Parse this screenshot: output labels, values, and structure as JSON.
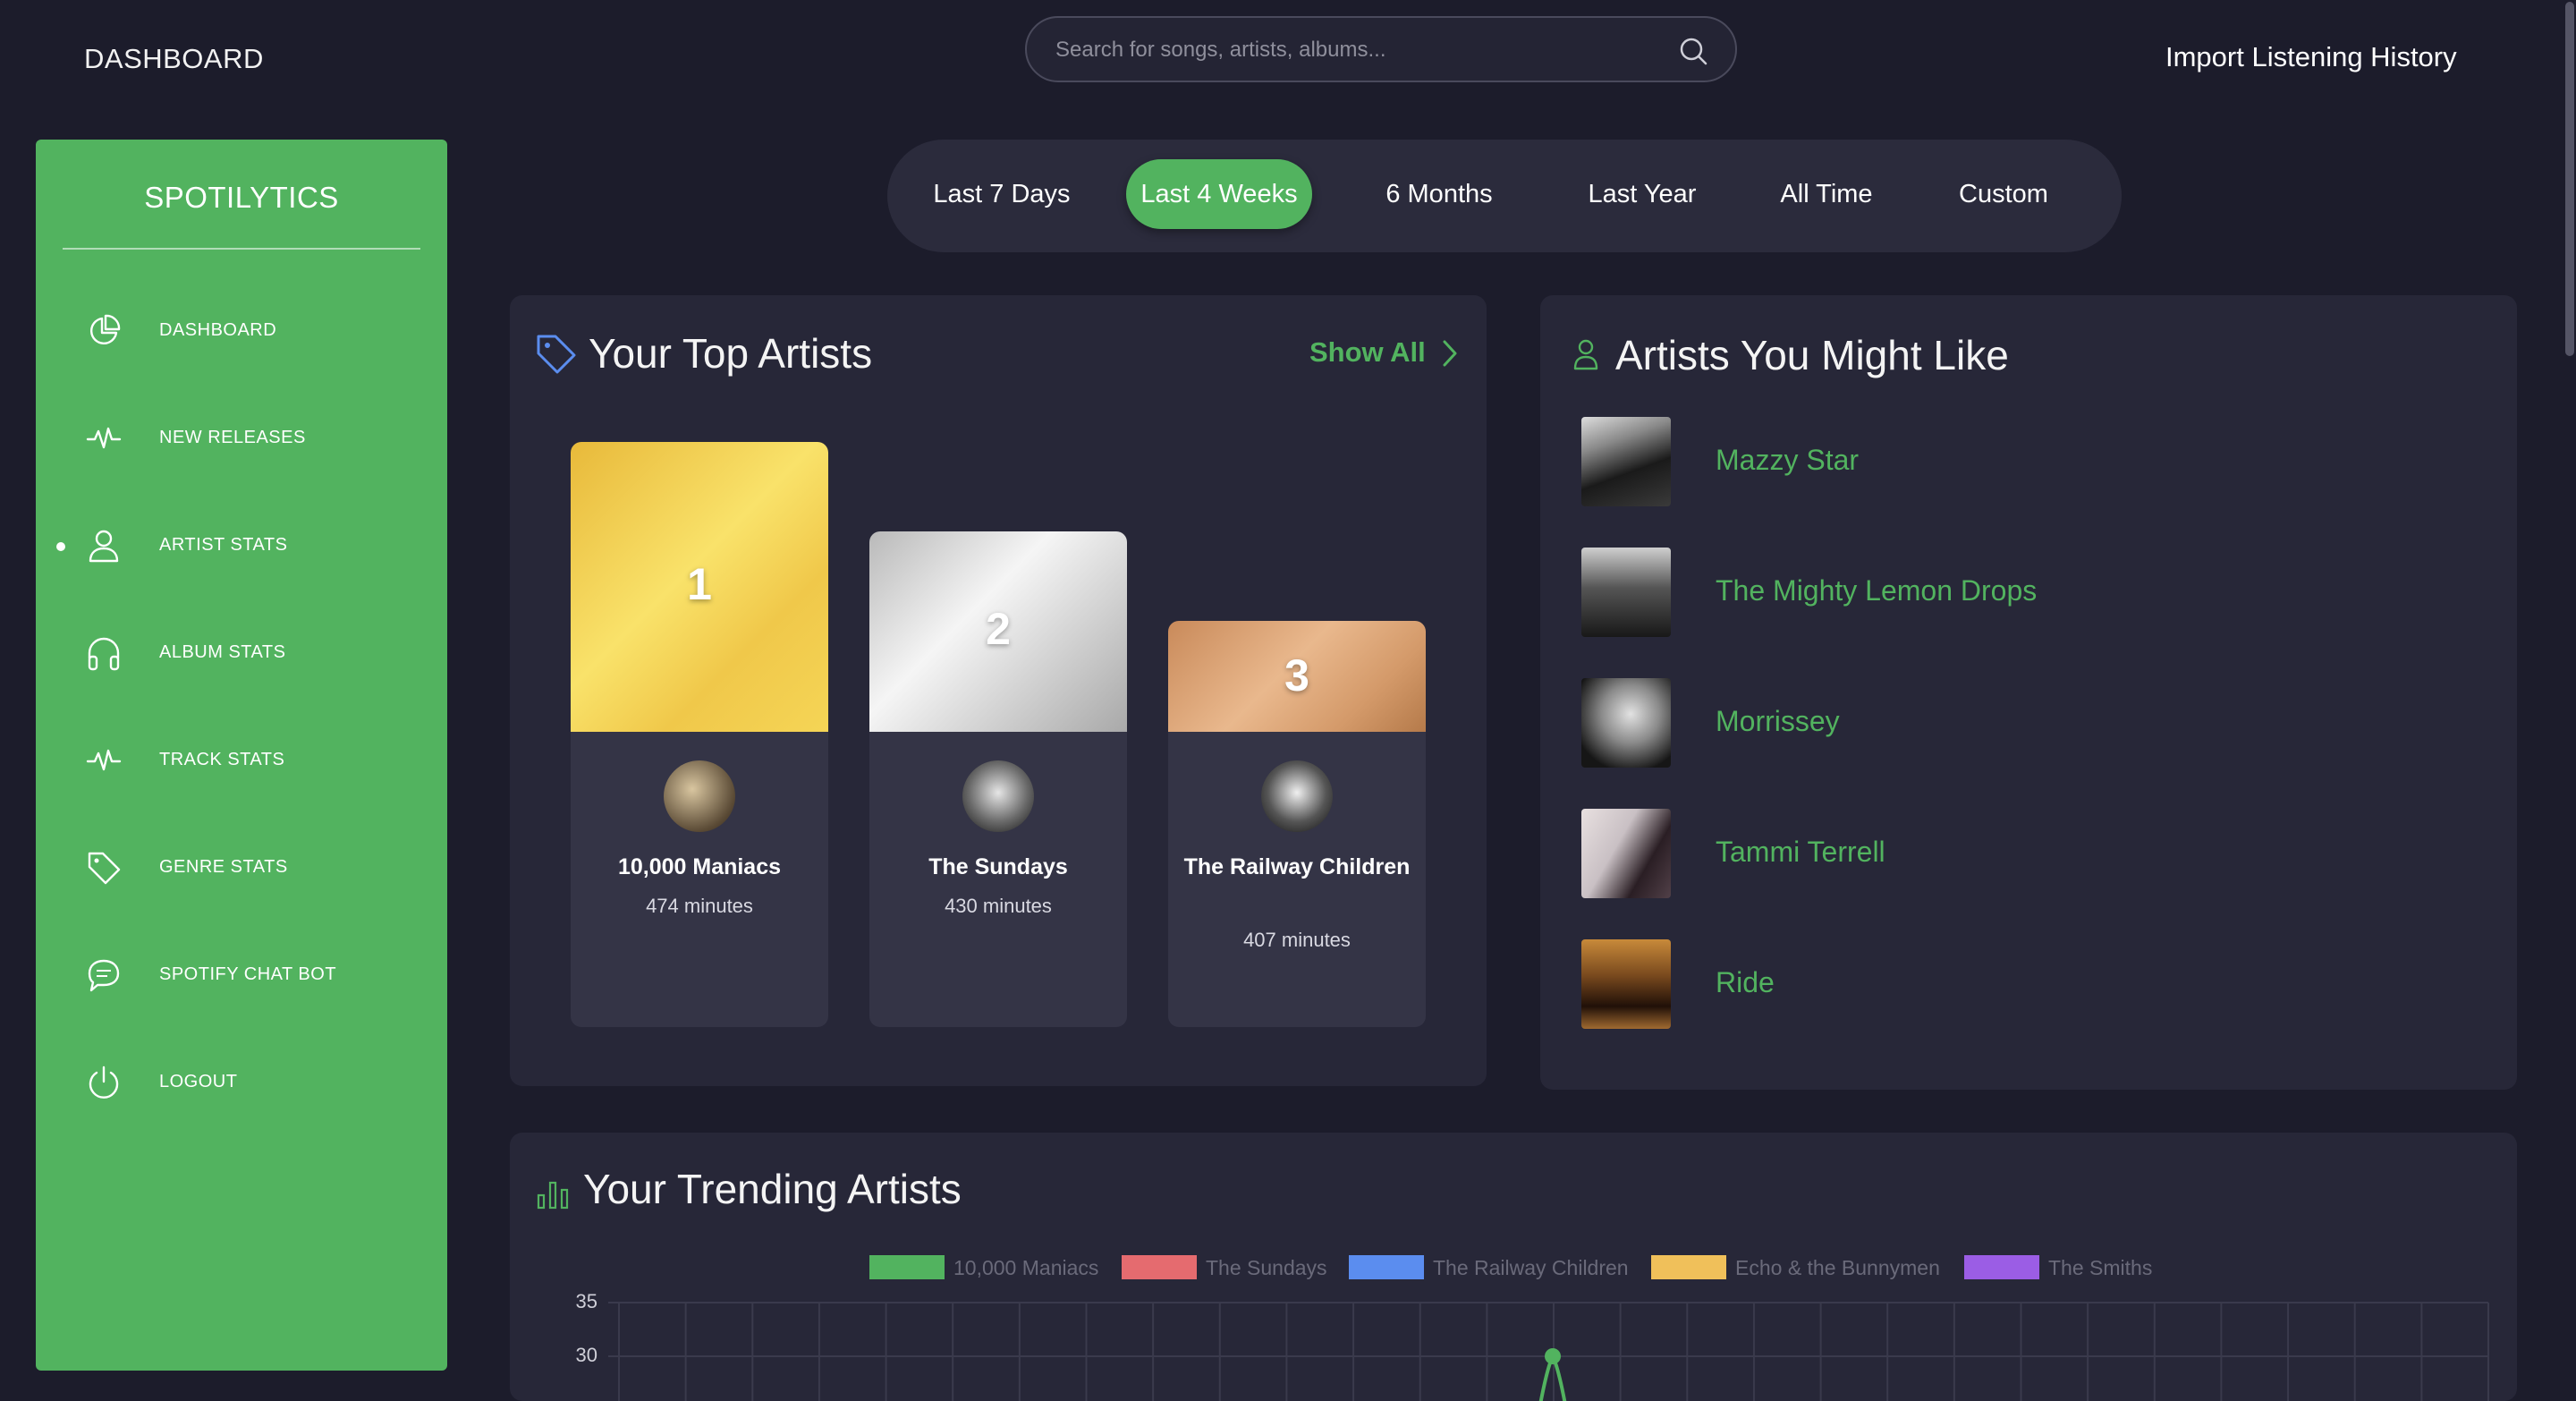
{
  "header": {
    "title": "DASHBOARD",
    "search_placeholder": "Search for songs, artists, albums...",
    "import_label": "Import Listening History"
  },
  "sidebar": {
    "brand": "SPOTILYTICS",
    "active_item": "ARTIST STATS",
    "items": [
      {
        "label": "DASHBOARD",
        "icon": "pie-chart-icon"
      },
      {
        "label": "NEW RELEASES",
        "icon": "pulse-icon"
      },
      {
        "label": "ARTIST STATS",
        "icon": "user-icon"
      },
      {
        "label": "ALBUM STATS",
        "icon": "headphones-icon"
      },
      {
        "label": "TRACK STATS",
        "icon": "pulse-icon"
      },
      {
        "label": "GENRE STATS",
        "icon": "tag-icon"
      },
      {
        "label": "SPOTIFY CHAT BOT",
        "icon": "chat-icon"
      },
      {
        "label": "LOGOUT",
        "icon": "power-icon"
      }
    ]
  },
  "periods": {
    "active": "Last 4 Weeks",
    "tabs": [
      "Last 7 Days",
      "Last 4 Weeks",
      "6 Months",
      "Last Year",
      "All Time",
      "Custom"
    ]
  },
  "top_artists": {
    "title": "Your Top Artists",
    "show_all": "Show All",
    "podium": [
      {
        "rank": "1",
        "name": "10,000 Maniacs",
        "minutes": "474 minutes"
      },
      {
        "rank": "2",
        "name": "The Sundays",
        "minutes": "430 minutes"
      },
      {
        "rank": "3",
        "name": "The Railway Children",
        "minutes": "407 minutes"
      }
    ]
  },
  "recommendations": {
    "title": "Artists You Might Like",
    "artists": [
      "Mazzy Star",
      "The Mighty Lemon Drops",
      "Morrissey",
      "Tammi Terrell",
      "Ride"
    ]
  },
  "trending": {
    "title": "Your Trending Artists"
  },
  "colors": {
    "accent": "#52b35f",
    "background": "#1c1c2b",
    "card": "#272738",
    "gold": "#f2c94c",
    "silver": "#d6d6d6",
    "bronze": "#d69a6a"
  },
  "chart_data": {
    "type": "line",
    "series": [
      {
        "name": "10,000 Maniacs",
        "color": "#52b35f"
      },
      {
        "name": "The Sundays",
        "color": "#e56b6f"
      },
      {
        "name": "The Railway Children",
        "color": "#5b8def"
      },
      {
        "name": "Echo & the Bunnymen",
        "color": "#f0c05a"
      },
      {
        "name": "The Smiths",
        "color": "#9b5de5"
      }
    ],
    "y_ticks": [
      "35",
      "30"
    ],
    "visible_points": [
      {
        "series": "10,000 Maniacs",
        "y": 30
      }
    ],
    "grid": true,
    "legend_position": "top"
  }
}
